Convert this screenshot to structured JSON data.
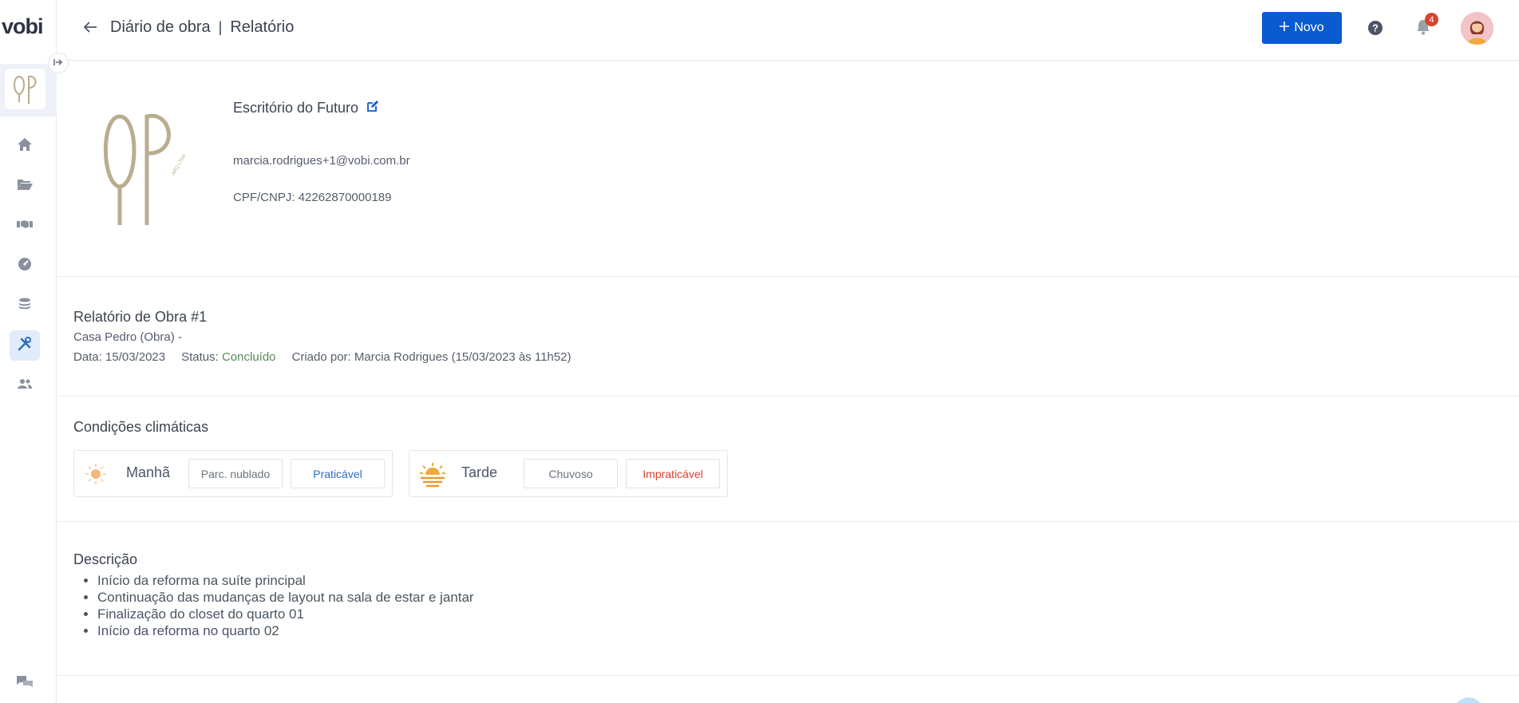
{
  "app": {
    "brand": "vobi"
  },
  "header": {
    "breadcrumb_section": "Diário de obra",
    "breadcrumb_separator": "|",
    "breadcrumb_page": "Relatório",
    "new_button_label": "Novo",
    "notifications_count": "4"
  },
  "sidebar": {
    "items": [
      {
        "icon": "home-icon",
        "active": false
      },
      {
        "icon": "folder-icon",
        "active": false
      },
      {
        "icon": "handshake-icon",
        "active": false
      },
      {
        "icon": "gauge-icon",
        "active": false
      },
      {
        "icon": "coins-icon",
        "active": false
      },
      {
        "icon": "tools-icon",
        "active": true
      },
      {
        "icon": "users-icon",
        "active": false
      }
    ]
  },
  "company": {
    "name": "Escritório do Futuro",
    "email": "marcia.rodrigues+1@vobi.com.br",
    "document": "CPF/CNPJ: 42262870000189"
  },
  "report": {
    "title": "Relatório de Obra #1",
    "work": "Casa Pedro (Obra) -",
    "date": "Data: 15/03/2023",
    "status_label": "Status:",
    "status_value": "Concluído",
    "created_by": "Criado por: Marcia Rodrigues (15/03/2023 às 11h52)"
  },
  "weather": {
    "title": "Condições climáticas",
    "morning": {
      "period": "Manhã",
      "condition": "Parc. nublado",
      "workability": "Praticável"
    },
    "afternoon": {
      "period": "Tarde",
      "condition": "Chuvoso",
      "workability": "Impraticável"
    }
  },
  "description": {
    "title": "Descrição",
    "items": [
      "Início da reforma na suíte principal",
      "Continuação das mudanças de layout na sala de estar e jantar",
      "Finalização do closet do quarto 01",
      "Início da reforma no quarto 02"
    ]
  },
  "colors": {
    "primary": "#0a5ad0",
    "status_done": "#5a8a58",
    "workable": "#2f6fbd",
    "unworkable": "#d9432d",
    "logo_gold": "#b9ad8d"
  }
}
